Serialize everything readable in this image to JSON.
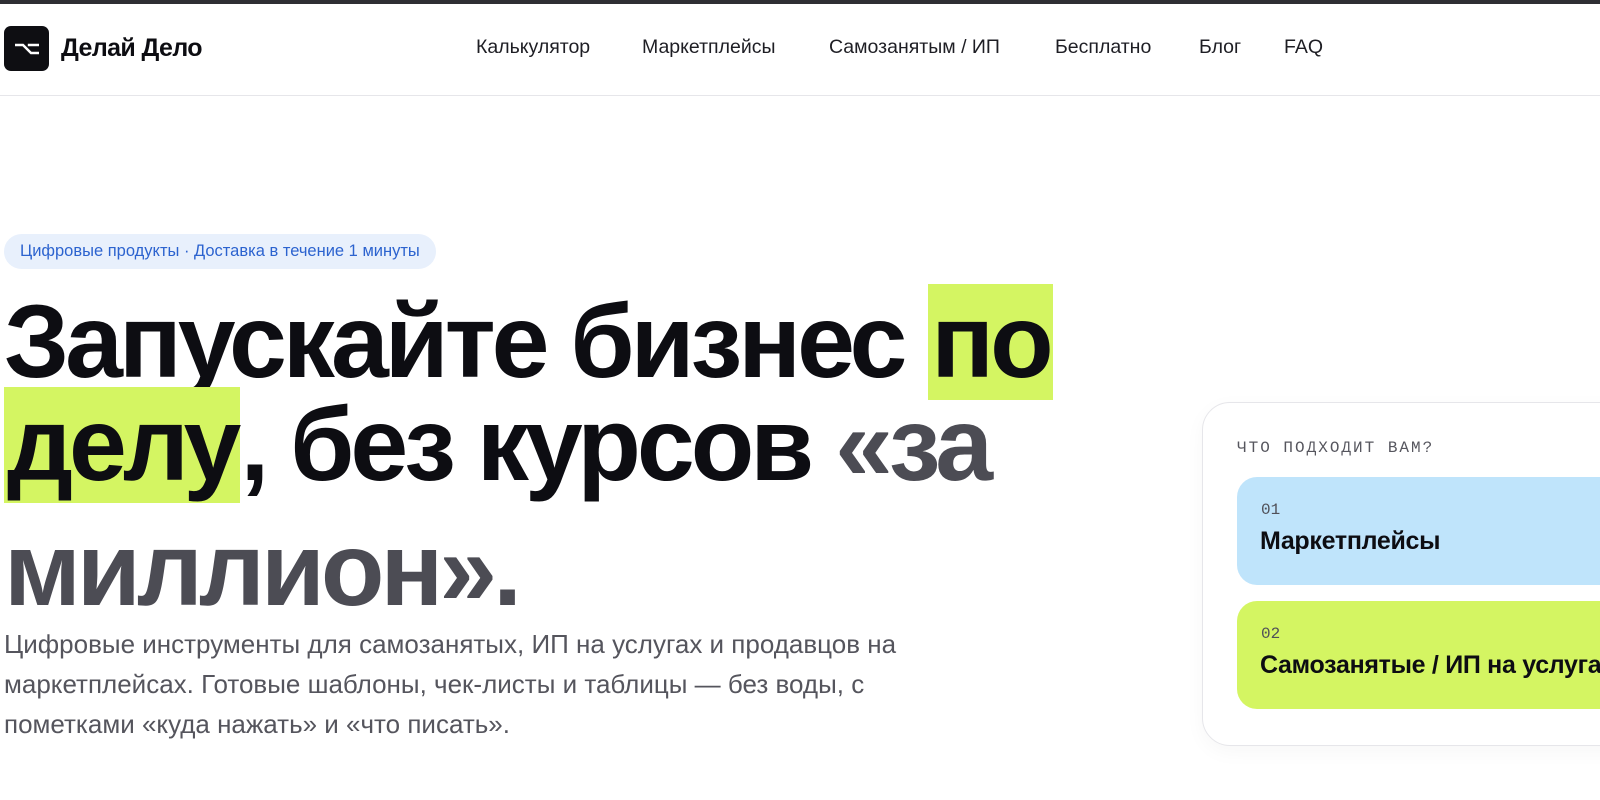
{
  "brand": {
    "name": "Делай Дело",
    "logo_icon": "option-key-icon"
  },
  "nav": {
    "items": [
      "Калькулятор",
      "Маркетплейсы",
      "Самозанятым / ИП",
      "Бесплатно",
      "Блог",
      "FAQ"
    ]
  },
  "hero": {
    "badge": "Цифровые продукты · Доставка в течение 1 минуты",
    "title_line1_a": "Запускайте бизнес ",
    "title_line1_hl": "по",
    "title_line2_hl": "делу",
    "title_line2_b": ", без курсов ",
    "title_line2_muted": "«за",
    "title_line3_muted": "миллион».",
    "lead": "Цифровые инструменты для самозанятых, ИП на услугах и продавцов на маркетплейсах. Готовые шаблоны, чек-листы и таблицы — без воды, с пометками «куда нажать» и «что писать»."
  },
  "chooser": {
    "label": "ЧТО ПОДХОДИТ ВАМ?",
    "options": [
      {
        "num": "01",
        "title": "Маркетплейсы",
        "color": "#bfe4fb"
      },
      {
        "num": "02",
        "title": "Самозанятые / ИП на услугах",
        "color": "#d4f562"
      }
    ]
  },
  "colors": {
    "accent_lime": "#d4f562",
    "accent_blue": "#bfe4fb",
    "badge_text": "#2c63cf",
    "text_dark": "#0d0d12"
  }
}
